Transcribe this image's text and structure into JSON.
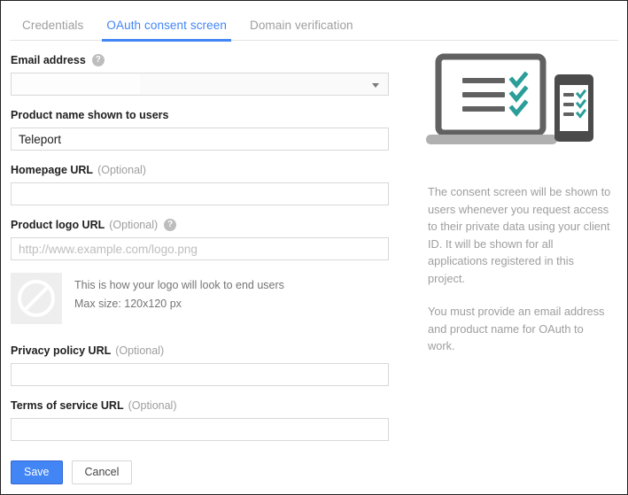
{
  "tabs": [
    {
      "label": "Credentials",
      "active": false
    },
    {
      "label": "OAuth consent screen",
      "active": true
    },
    {
      "label": "Domain verification",
      "active": false
    }
  ],
  "form": {
    "email": {
      "label": "Email address",
      "help_icon": "help-icon",
      "value": "",
      "caret_icon": "chevron-down-icon"
    },
    "product_name": {
      "label": "Product name shown to users",
      "value": "Teleport",
      "placeholder": ""
    },
    "homepage_url": {
      "label": "Homepage URL",
      "optional": "(Optional)",
      "value": "",
      "placeholder": ""
    },
    "product_logo_url": {
      "label": "Product logo URL",
      "optional": "(Optional)",
      "help_icon": "help-icon",
      "value": "",
      "placeholder": "http://www.example.com/logo.png"
    },
    "logo_preview": {
      "icon": "no-image-icon",
      "line1": "This is how your logo will look to end users",
      "line2": "Max size: 120x120 px"
    },
    "privacy_policy_url": {
      "label": "Privacy policy URL",
      "optional": "(Optional)",
      "value": "",
      "placeholder": ""
    },
    "terms_of_service_url": {
      "label": "Terms of service URL",
      "optional": "(Optional)",
      "value": "",
      "placeholder": ""
    }
  },
  "actions": {
    "save_label": "Save",
    "cancel_label": "Cancel"
  },
  "side_panel": {
    "illustration": "laptop-and-phone-checklist-illustration",
    "paragraph1": "The consent screen will be shown to users whenever you request access to their private data using your client ID. It will be shown for all applications registered in this project.",
    "paragraph2": "You must provide an email address and product name for OAuth to work."
  },
  "colors": {
    "accent": "#4285f4",
    "primary_button": "#4285f4",
    "label_text": "#212121",
    "muted_text": "#9e9e9e",
    "illustration_gray": "#616161",
    "illustration_teal": "#2b9e9a",
    "input_border": "#d8d8d8"
  }
}
